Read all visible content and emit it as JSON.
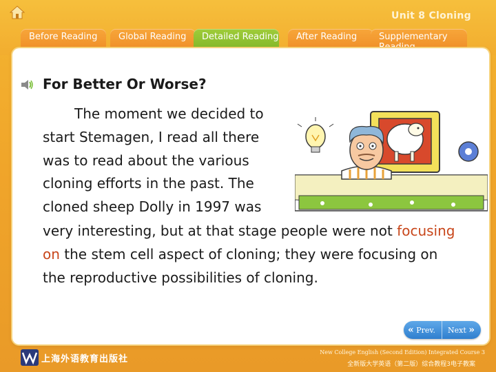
{
  "header": {
    "unit_title": "Unit 8 Cloning"
  },
  "tabs": [
    {
      "label": "Before Reading",
      "active": false
    },
    {
      "label": "Global Reading",
      "active": false
    },
    {
      "label": "Detailed Reading",
      "active": true
    },
    {
      "label": "After Reading",
      "active": false
    },
    {
      "label": "Supplementary Reading",
      "active": false
    }
  ],
  "content": {
    "heading": "For Better Or Worse?",
    "para1": "The moment we decided to start Stemagen, I read all there was to read about the various cloning efforts in the past. The cloned sheep Dolly in 1997 was",
    "para2_pre": "very interesting, but at that stage people were not ",
    "para2_highlight": "focusing on",
    "para2_post": " the stem cell aspect of cloning; they were focusing on the reproductive possibilities of cloning."
  },
  "nav": {
    "prev_label": "Prev.",
    "next_label": "Next"
  },
  "footer": {
    "publisher": "上海外语教育出版社",
    "course_en": "New College English (Second Edition) Integrated Course 3",
    "course_cn": "全新版大学英语（第二版）综合教程3电子教案"
  },
  "colors": {
    "accent_orange": "#f0a52a",
    "tab_active": "#8cbf2c",
    "highlight": "#c8461a",
    "nav_blue": "#3b8ad6"
  },
  "icons": [
    "home-icon",
    "speaker-icon",
    "chevron-left-icon",
    "chevron-right-icon"
  ]
}
